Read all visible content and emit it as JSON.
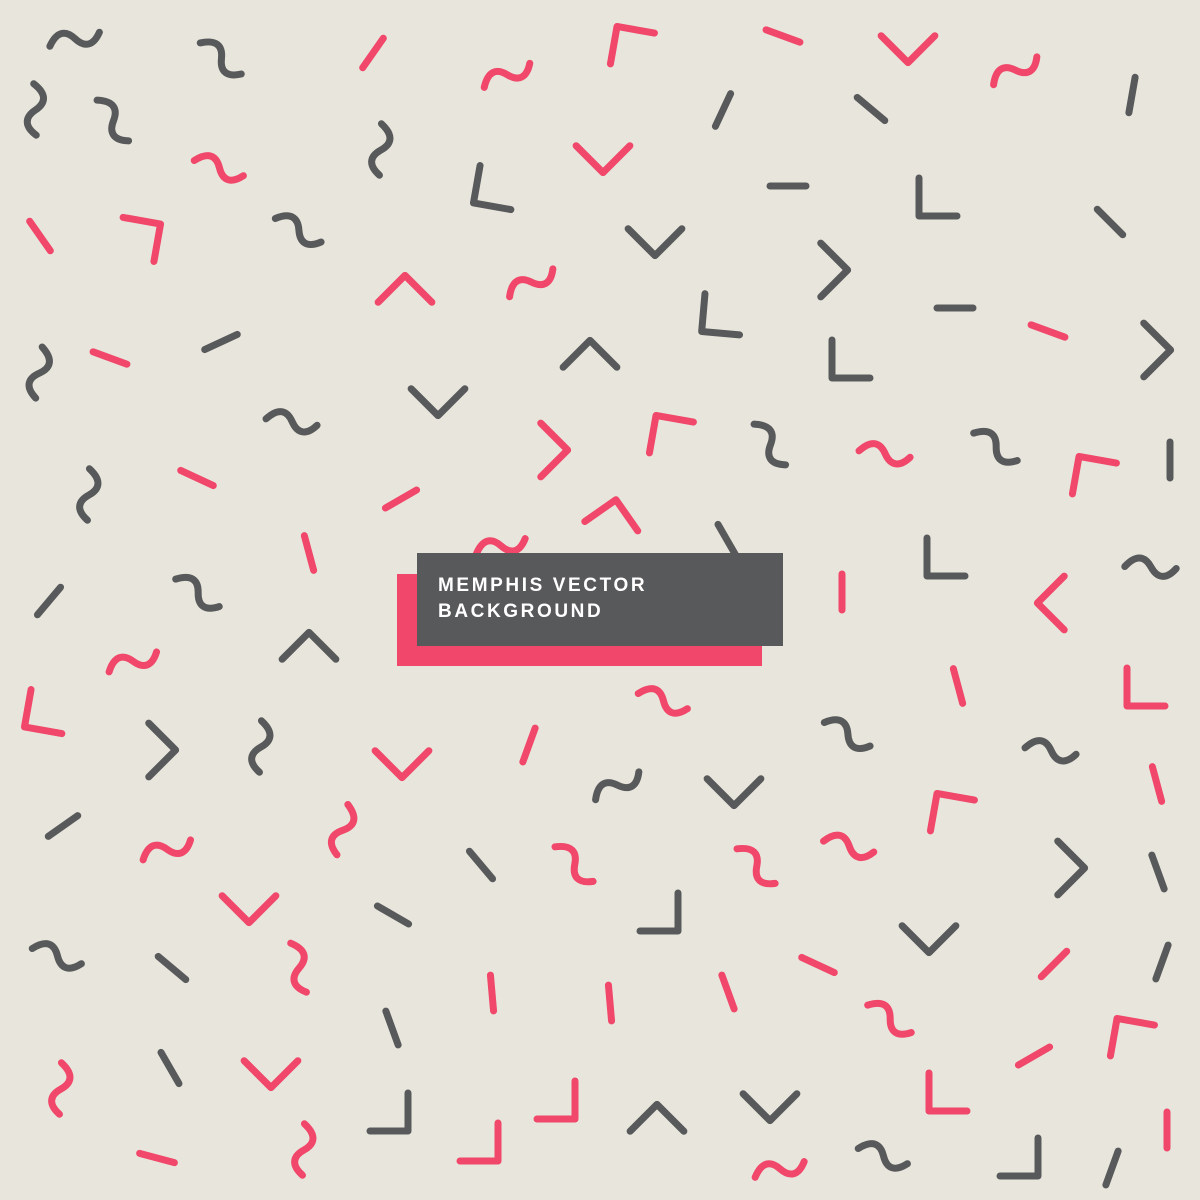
{
  "label": {
    "line1": "MEMPHIS VECTOR",
    "line2": "BACKGROUND"
  },
  "colors": {
    "background": "#e8e6dc",
    "gray": "#58595b",
    "pink": "#f0476a",
    "label_text": "#ffffff"
  },
  "pattern": {
    "shape_kinds": [
      "squiggle",
      "chevron",
      "dash"
    ]
  }
}
